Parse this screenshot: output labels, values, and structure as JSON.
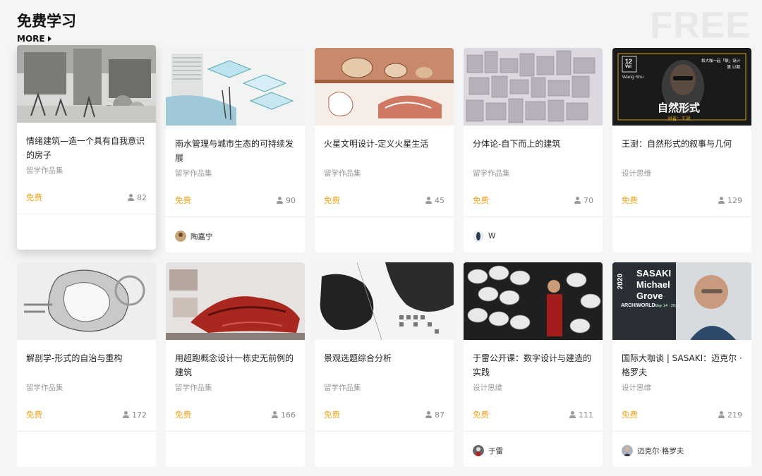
{
  "section": {
    "title": "免费学习",
    "more": "MORE",
    "watermark": "FREE"
  },
  "cards": [
    {
      "title": "情绪建筑—造一个具有自我意识的房子",
      "category": "留学作品集",
      "price": "免费",
      "count": "82",
      "author": ""
    },
    {
      "title": "雨水管理与城市生态的可持续发展",
      "category": "留学作品集",
      "price": "免费",
      "count": "90",
      "author": "陶嘉宁"
    },
    {
      "title": "火星文明设计-定义火星生活",
      "category": "留学作品集",
      "price": "免费",
      "count": "45",
      "author": ""
    },
    {
      "title": "分体论-自下而上的建筑",
      "category": "留学作品集",
      "price": "免费",
      "count": "70",
      "author": "W"
    },
    {
      "title": "王澍：自然形式的叙事与几何",
      "category": "设计思维",
      "price": "免费",
      "count": "129",
      "author": ""
    },
    {
      "title": "解剖学-形式的自治与重构",
      "category": "留学作品集",
      "price": "免费",
      "count": "172",
      "author": ""
    },
    {
      "title": "用超跑概念设计一栋史无前例的建筑",
      "category": "留学作品集",
      "price": "免费",
      "count": "166",
      "author": ""
    },
    {
      "title": "景观选题综合分析",
      "category": "留学作品集",
      "price": "免费",
      "count": "87",
      "author": ""
    },
    {
      "title": "于雷公开课：数字设计与建造的实践",
      "category": "设计思维",
      "price": "免费",
      "count": "111",
      "author": "于雷"
    },
    {
      "title": "国际大咖谈 | SASAKI：迈克尔 · 格罗夫",
      "category": "设计思维",
      "price": "免费",
      "count": "219",
      "author": "迈克尔·格罗夫"
    }
  ],
  "thumb_text": {
    "wang_vol_num": "12",
    "wang_vol": "Vol",
    "wang_name_en": "Wang Shu",
    "wang_series": "和大咖一起「聊」设计",
    "wang_issue": "第 12期",
    "wang_title": "自然形式",
    "wang_speaker": "讲者：王澍",
    "sasaki_year": "2020",
    "sasaki_line1": "SASAKI",
    "sasaki_line2": "Michael",
    "sasaki_line3": "Grove",
    "sasaki_brand": "ARCHIWORLD",
    "sasaki_date": "May 14 · 20:00"
  },
  "colors": {
    "price": "#f5a623",
    "accent_gold": "#d4a017"
  }
}
